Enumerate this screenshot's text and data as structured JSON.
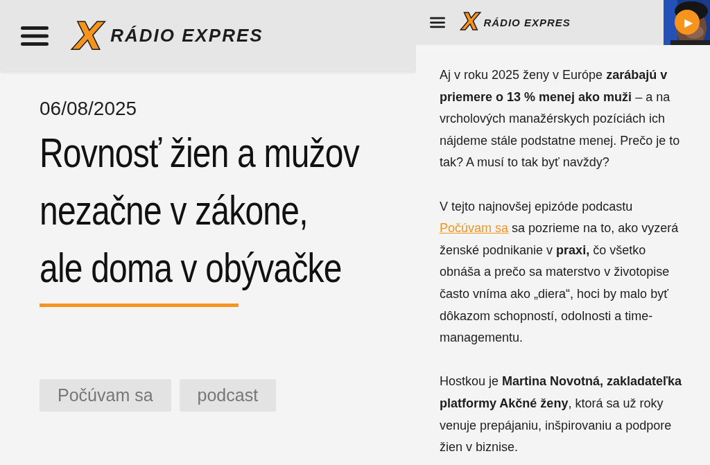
{
  "left": {
    "header": {
      "logo_mark": "X",
      "logo_text": "RÁDIO EXPRES"
    },
    "date": "06/08/2025",
    "title_lines": [
      "Rovnosť žien a mužov",
      "nezačne v zákone,",
      "ale doma v obývačke"
    ],
    "tags": [
      "Počúvam sa",
      "podcast"
    ]
  },
  "right": {
    "header": {
      "logo_mark": "X",
      "logo_text": "RÁDIO EXPRES"
    },
    "player": {
      "kind": "picture",
      "play_icon": "▶"
    },
    "paragraphs": [
      {
        "text": "Aj v roku 2025 ženy v Európe **zarábajú v priemere o 13 % menej ako muži** – a na vrcholových manažérskych pozíciách ich nájdeme stále podstatne menej. Prečo je to tak? A musí to tak byť navždy?"
      },
      {
        "before": "V tejto najnovšej epizóde podcastu",
        "link": "Počúvam sa",
        "text": "sa pozrieme na to, ako vyzerá ženské podnikanie v **praxi,** čo všetko obnáša a prečo sa materstvo v životopise často vníma ako „diera“, hoci by malo byť dôkazom schopností, odolnosti a time-managementu."
      },
      {
        "text": "Hostkou je **Martina Novotná, zakladateľka platformy Akčné ženy**, ktorá sa už roky venuje prepájaniu, inšpirovaniu a podpore žien v biznise."
      }
    ]
  }
}
